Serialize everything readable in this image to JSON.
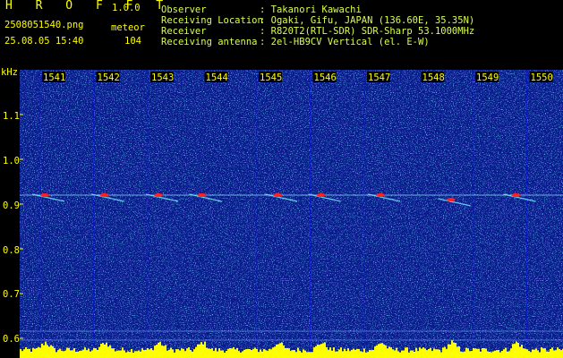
{
  "header": {
    "app_title": "H R O F F T",
    "version": "1.0.0",
    "filename": "2508051540.png",
    "mode_label": "meteor",
    "datetime": "25.08.05 15:40",
    "count": "104",
    "info": [
      {
        "label": "Observer",
        "value": ": Takanori Kawachi"
      },
      {
        "label": "Receiving Location",
        "value": ": Ogaki, Gifu, JAPAN (136.60E, 35.35N)"
      },
      {
        "label": "Receiver",
        "value": ": R820T2(RTL-SDR) SDR-Sharp 53.1000MHz"
      },
      {
        "label": "Receiving antenna",
        "value": ": 2el-HB9CV Vertical (el. E-W)"
      }
    ]
  },
  "axis": {
    "y_unit": "kHz",
    "y_ticks": [
      "1.1",
      "1.0",
      "0.9",
      "0.8",
      "0.7",
      "0.6"
    ],
    "x_ticks": [
      "1541",
      "1542",
      "1543",
      "1544",
      "1545",
      "1546",
      "1547",
      "1548",
      "1549",
      "1550"
    ]
  },
  "colors": {
    "background": "#000000",
    "spectrogram_base": "#0a1a8c",
    "noise_cyan": "#38c8ff",
    "signal_red": "#ff2020",
    "level_bar": "#ffff00",
    "text_yellow": "#ffff00"
  },
  "chart_data": {
    "type": "heatmap",
    "xlabel": "",
    "ylabel": "kHz",
    "x_ticks": [
      1541,
      1542,
      1543,
      1544,
      1545,
      1546,
      1547,
      1548,
      1549,
      1550
    ],
    "y_ticks": [
      1.1,
      1.0,
      0.9,
      0.8,
      0.7,
      0.6
    ],
    "ylim": [
      0.58,
      1.18
    ],
    "carrier_khz": 0.92,
    "meteor_echoes": [
      {
        "x": 1541.1,
        "y": 0.92
      },
      {
        "x": 1542.2,
        "y": 0.92
      },
      {
        "x": 1543.2,
        "y": 0.92
      },
      {
        "x": 1544.0,
        "y": 0.92
      },
      {
        "x": 1545.4,
        "y": 0.92
      },
      {
        "x": 1546.2,
        "y": 0.92
      },
      {
        "x": 1547.3,
        "y": 0.92
      },
      {
        "x": 1548.6,
        "y": 0.91
      },
      {
        "x": 1549.8,
        "y": 0.92
      }
    ]
  }
}
